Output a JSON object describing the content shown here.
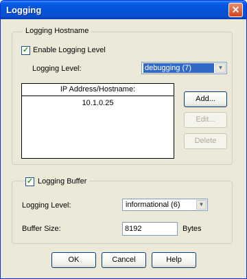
{
  "window": {
    "title": "Logging"
  },
  "hostname_group": {
    "legend": "Logging Hostname",
    "enable_label": "Enable Logging Level",
    "enable_checked": true,
    "level_label": "Logging Level:",
    "level_value": "debugging (7)",
    "list_header": "IP Address/Hostname:",
    "hosts": [
      "10.1.0.25"
    ],
    "add_label": "Add...",
    "edit_label": "Edit...",
    "delete_label": "Delete"
  },
  "buffer_group": {
    "legend": "Logging Buffer",
    "checked": true,
    "level_label": "Logging Level:",
    "level_value": "informational (6)",
    "size_label": "Buffer Size:",
    "size_value": "8192",
    "size_unit": "Bytes"
  },
  "footer": {
    "ok_label": "OK",
    "cancel_label": "Cancel",
    "help_label": "Help"
  }
}
